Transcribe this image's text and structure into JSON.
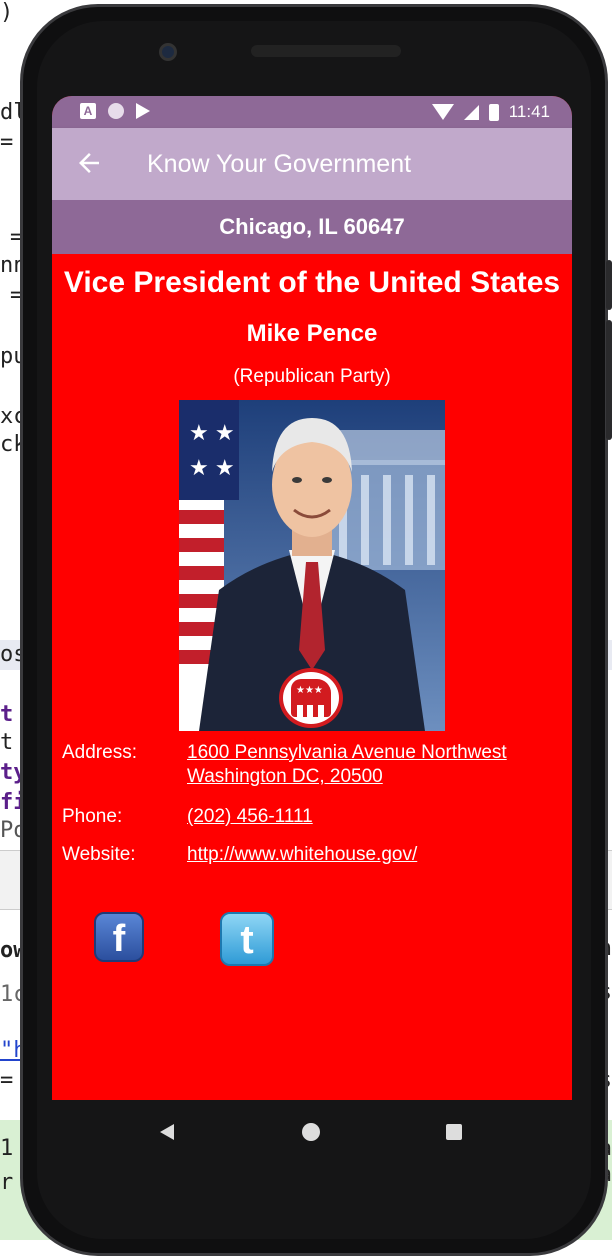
{
  "background_code": {
    "left_fragments": [
      ")",
      "dl",
      "=",
      "=",
      "nn",
      "=",
      "pu",
      "xc",
      "ck",
      "os",
      "t",
      "t",
      "ty",
      "fi",
      "Po",
      "ow",
      "1c",
      "\"h",
      "=",
      "1 s",
      "r"
    ],
    "right_fragments": [
      "n",
      "s",
      "s",
      "s",
      "-a",
      "a"
    ]
  },
  "status_bar": {
    "time": "11:41",
    "notification_icon_letter": "A"
  },
  "app_bar": {
    "title": "Know Your Government",
    "back_icon": "arrow-left-icon"
  },
  "location": "Chicago, IL 60647",
  "official": {
    "office": "Vice President of the United States",
    "name": "Mike Pence",
    "party": "(Republican Party)",
    "party_logo": "republican-elephant-icon"
  },
  "contact": {
    "address_label": "Address:",
    "address_line1": "1600 Pennsylvania Avenue Northwest",
    "address_line2": "Washington DC, 20500",
    "phone_label": "Phone:",
    "phone": "(202) 456-1111",
    "website_label": "Website:",
    "website": "http://www.whitehouse.gov/"
  },
  "social": {
    "facebook_icon_letter": "f",
    "twitter_icon_letter": "t"
  },
  "colors": {
    "content_bg": "#ff0000",
    "status_bar": "#8e6997",
    "app_bar": "#c1a9cb",
    "location_bar": "#8e6997"
  }
}
